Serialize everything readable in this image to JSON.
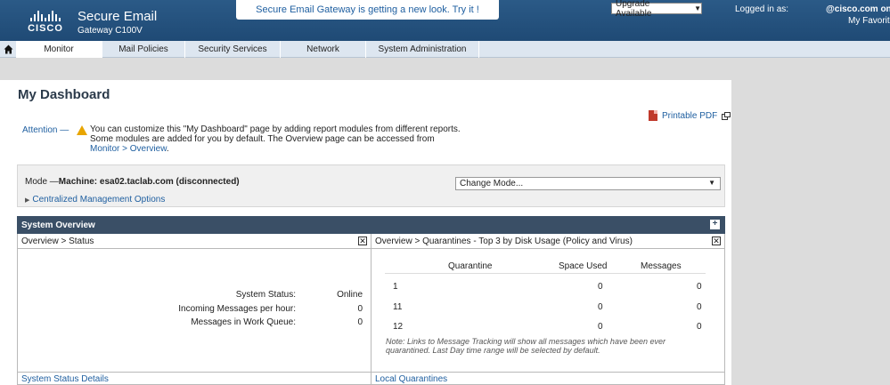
{
  "header": {
    "brand": "CISCO",
    "product_name": "Secure Email",
    "product_model": "Gateway C100V",
    "banner": "Secure Email Gateway is getting a new look. Try it !",
    "upgrade": "Upgrade Available",
    "logged_in_label": "Logged in as:",
    "logged_in_user": "@cisco.com on",
    "favorites": "My Favorite"
  },
  "nav": {
    "tabs": [
      {
        "label": "Monitor",
        "active": true
      },
      {
        "label": "Mail Policies",
        "active": false
      },
      {
        "label": "Security Services",
        "active": false
      },
      {
        "label": "Network",
        "active": false
      },
      {
        "label": "System Administration",
        "active": false
      }
    ]
  },
  "main": {
    "title": "My Dashboard",
    "printable": "Printable PDF",
    "attention_label": "Attention —",
    "attention_line1": "You can customize this \"My Dashboard\" page by adding report modules from different reports.",
    "attention_line2": "Some modules are added for you by default. The Overview page can be accessed from",
    "attention_link": "Monitor > Overview",
    "attention_end": ".",
    "mode_prefix": "Mode —",
    "mode_value": "Machine: esa02.taclab.com (disconnected)",
    "change_mode": "Change Mode...",
    "cmo": "Centralized Management Options",
    "system_overview": "System Overview"
  },
  "status_panel": {
    "title": "Overview > Status",
    "rows": [
      {
        "label": "System Status:",
        "value": "Online"
      },
      {
        "label": "Incoming Messages per hour:",
        "value": "0"
      },
      {
        "label": "Messages in Work Queue:",
        "value": "0"
      }
    ],
    "footer": "System Status Details"
  },
  "quarantine_panel": {
    "title": "Overview > Quarantines - Top 3 by Disk Usage (Policy and Virus)",
    "headers": [
      "Quarantine",
      "Space Used",
      "Messages"
    ],
    "rows": [
      [
        "1",
        "0",
        "0"
      ],
      [
        "11",
        "0",
        "0"
      ],
      [
        "12",
        "0",
        "0"
      ]
    ],
    "note": "Note: Links to Message Tracking will show all messages which have been ever quarantined. Last Day time range will be selected by default.",
    "footer": "Local Quarantines"
  }
}
